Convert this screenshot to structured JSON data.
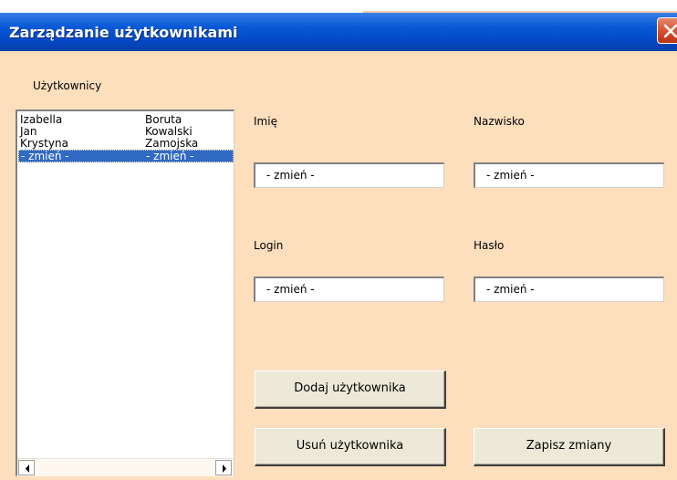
{
  "window": {
    "title": "Zarządzanie użytkownikami"
  },
  "users_label": "Użytkownicy",
  "users": [
    {
      "first": "Izabella",
      "last": "Boruta",
      "selected": false
    },
    {
      "first": "Jan",
      "last": "Kowalski",
      "selected": false
    },
    {
      "first": "Krystyna",
      "last": "Zamojska",
      "selected": false
    },
    {
      "first": "- zmień -",
      "last": "- zmień -",
      "selected": true
    }
  ],
  "fields": {
    "first_name": {
      "label": "Imię",
      "value": "- zmień -"
    },
    "last_name": {
      "label": "Nazwisko",
      "value": "- zmień -"
    },
    "login": {
      "label": "Login",
      "value": "- zmień -"
    },
    "password": {
      "label": "Hasło",
      "value": "- zmień -"
    }
  },
  "buttons": {
    "add": "Dodaj użytkownika",
    "remove": "Usuń użytkownika",
    "save": "Zapisz zmiany"
  },
  "icons": {
    "close": "close-icon",
    "scroll_left": "arrow-left-icon",
    "scroll_right": "arrow-right-icon"
  },
  "colors": {
    "titlebar": "#0a5ad8",
    "client_bg": "#fddfbe",
    "selection": "#316ac5",
    "close_button": "#d4482a"
  }
}
